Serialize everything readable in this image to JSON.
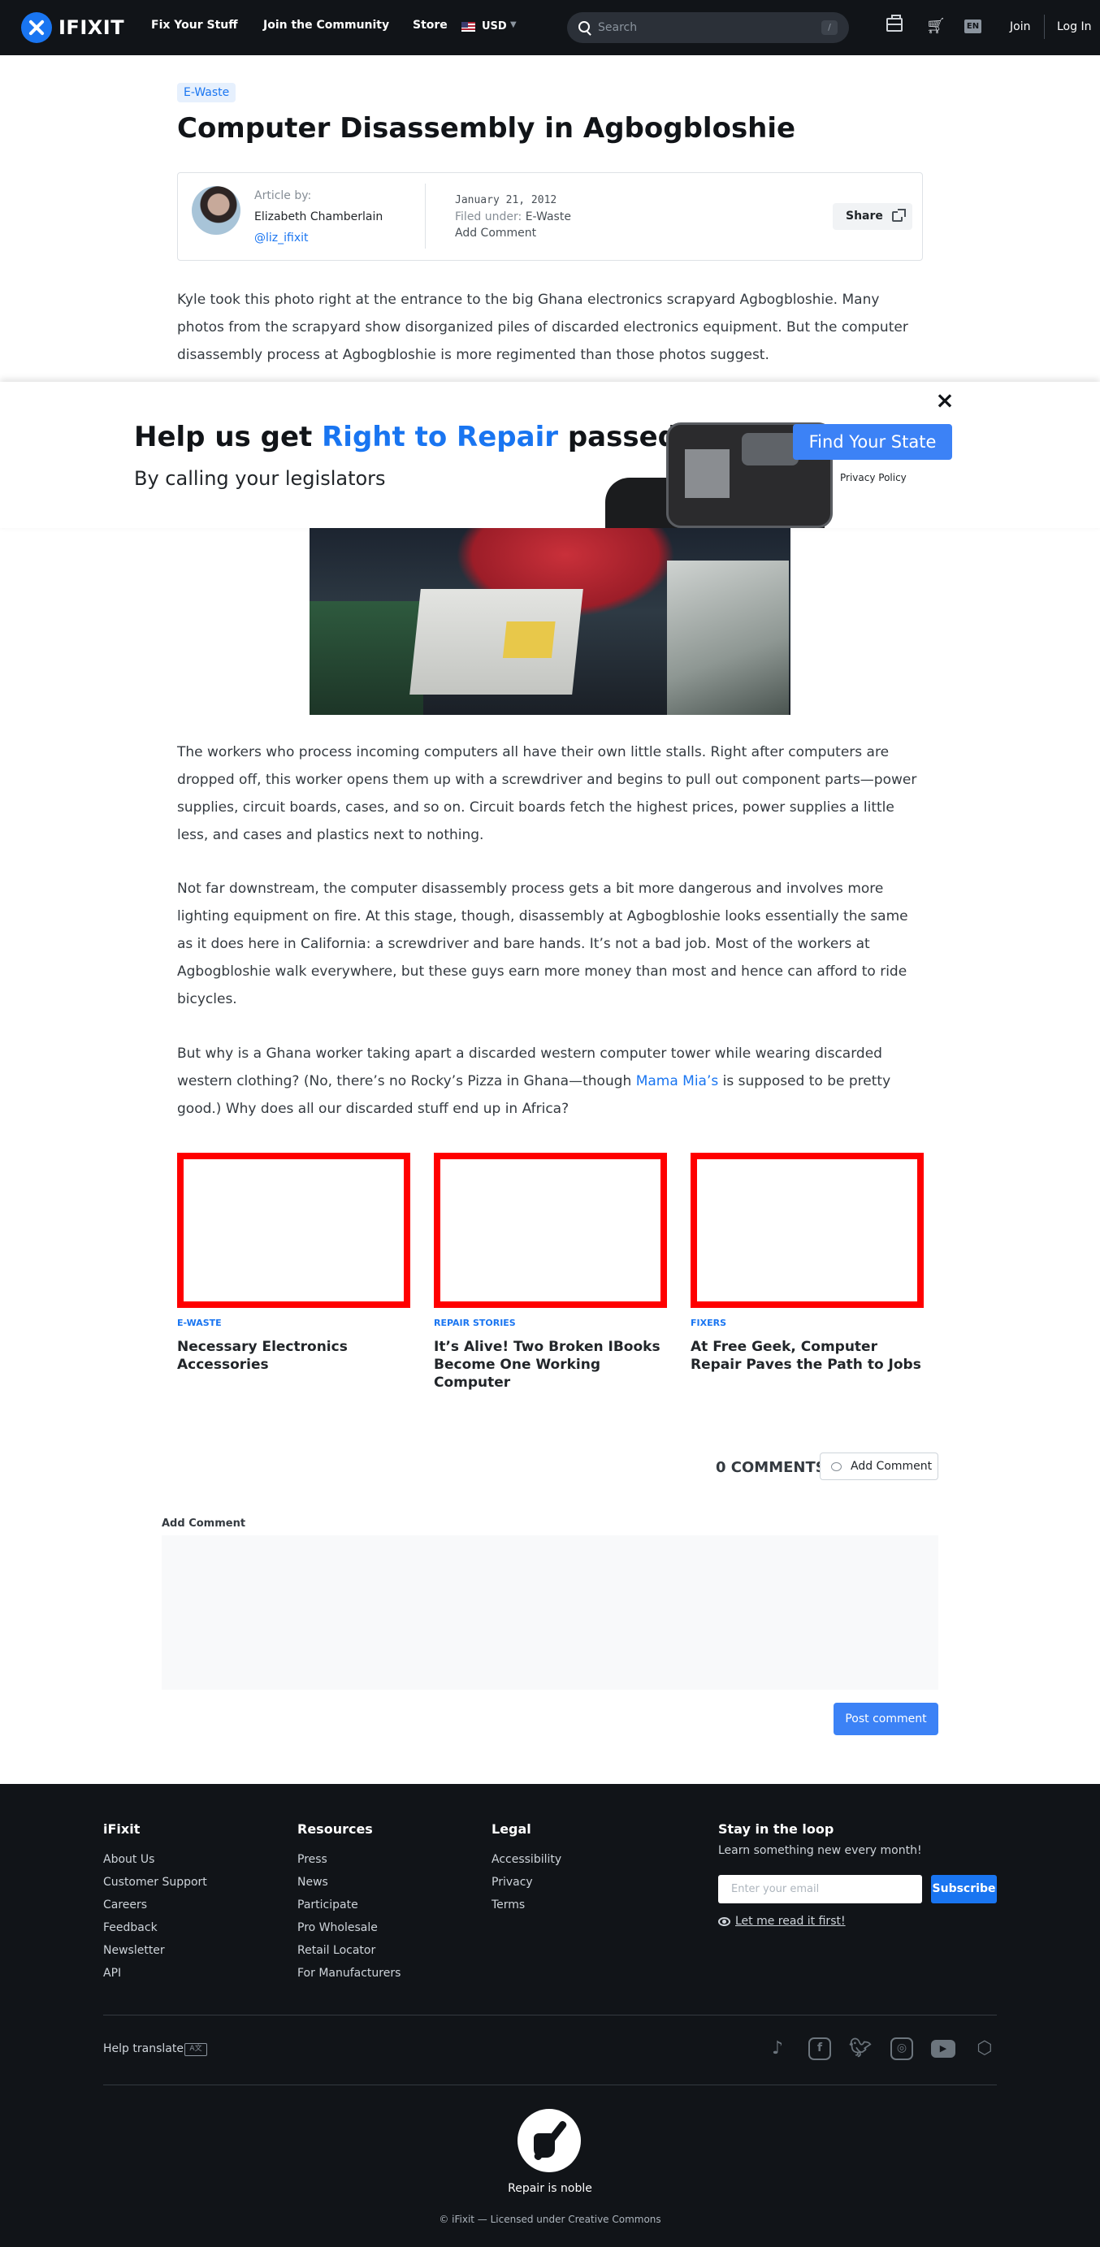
{
  "nav": {
    "logo_text": "IFIXIT",
    "links": [
      "Fix Your Stuff",
      "Join the Community",
      "Store"
    ],
    "currency": "USD",
    "search_placeholder": "Search",
    "search_shortcut": "/",
    "language": "EN",
    "join": "Join",
    "login": "Log In"
  },
  "article": {
    "category": "E-Waste",
    "title": "Computer Disassembly in Agbogbloshie",
    "byline": {
      "label": "Article by:",
      "author": "Elizabeth Chamberlain",
      "handle": "@liz_ifixit",
      "date": "January 21, 2012",
      "filed_label": "Filed under: ",
      "filed_category": "E-Waste",
      "add_comment": "Add Comment",
      "share": "Share"
    },
    "intro": "Kyle took this photo right at the entrance to the big Ghana electronics scrapyard Agbogbloshie. Many photos from the scrapyard show disorganized piles of discarded electronics equipment. But the computer disassembly process at Agbogbloshie is more regimented than those photos suggest.",
    "p2": "The workers who process incoming computers all have their own little stalls. Right after computers are dropped off, this worker opens them up with a screwdriver and begins to pull out component parts—power supplies, circuit boards, cases, and so on. Circuit boards fetch the highest prices, power supplies a little less, and cases and plastics next to nothing.",
    "p3": "Not far downstream, the computer disassembly process gets a bit more dangerous and involves more lighting equipment on fire. At this stage, though, disassembly at Agbogbloshie looks essentially the same as it does here in California: a screwdriver and bare hands. It’s not a bad job. Most of the workers at Agbogbloshie walk everywhere, but these guys earn more money than most and hence can afford to ride bicycles.",
    "p4_before": "But why is a Ghana worker taking apart a discarded western computer tower while wearing discarded western clothing? (No, there’s no Rocky’s Pizza in Ghana—though ",
    "p4_link": "Mama Mia’s",
    "p4_after": " is supposed to be pretty good.) Why does all our discarded stuff end up in Africa?"
  },
  "banner": {
    "title_pre": "Help us get ",
    "title_accent": "Right to Repair",
    "title_post": " passed",
    "subtitle": "By calling your legislators",
    "cta": "Find Your State",
    "privacy": "Privacy Policy",
    "close": "×"
  },
  "related": [
    {
      "category": "E-WASTE",
      "title": "Necessary Electronics Accessories"
    },
    {
      "category": "REPAIR STORIES",
      "title": "It’s Alive! Two Broken IBooks Become One Working Computer"
    },
    {
      "category": "FIXERS",
      "title": "At Free Geek, Computer Repair Paves the Path to Jobs"
    }
  ],
  "comments": {
    "count": "0 COMMENTS",
    "add_button": "Add Comment",
    "form_label": "Add Comment",
    "post_button": "Post comment"
  },
  "footer": {
    "columns": [
      {
        "heading": "iFixit",
        "items": [
          "About Us",
          "Customer Support",
          "Careers",
          "Feedback",
          "Newsletter",
          "API"
        ]
      },
      {
        "heading": "Resources",
        "items": [
          "Press",
          "News",
          "Participate",
          "Pro Wholesale",
          "Retail Locator",
          "For Manufacturers"
        ]
      },
      {
        "heading": "Legal",
        "items": [
          "Accessibility",
          "Privacy",
          "Terms"
        ]
      }
    ],
    "newsletter": {
      "heading": "Stay in the loop",
      "subtitle": "Learn something new every month!",
      "placeholder": "Enter your email",
      "subscribe": "Subscribe",
      "read_link": "Let me read it first!"
    },
    "help_translate": "Help translate",
    "tagline": "Repair is noble",
    "license": "© iFixit — Licensed under Creative Commons"
  },
  "colors": {
    "accent": "#1975f1",
    "cta": "#3c82f6",
    "nav_bg": "#111418",
    "related_border": "#ff0000"
  },
  "icons": [
    "search-icon",
    "toolbox-icon",
    "cart-icon",
    "share-icon",
    "close-icon",
    "comment-icon",
    "eye-icon",
    "translate-icon",
    "tiktok-icon",
    "facebook-icon",
    "twitter-icon",
    "instagram-icon",
    "youtube-icon",
    "repair-manifesto-icon"
  ]
}
